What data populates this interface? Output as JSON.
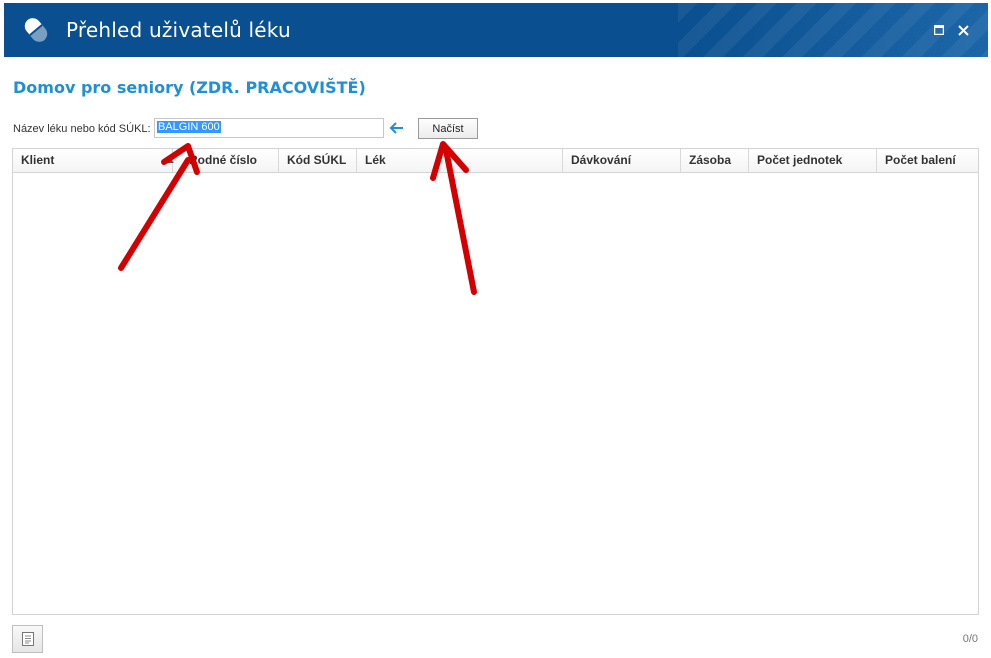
{
  "window": {
    "title": "Přehled uživatelů léku",
    "accent_color": "#0a4f8f",
    "icons": {
      "app": "pill-icon",
      "maximize": "maximize-icon",
      "close": "close-icon"
    }
  },
  "section": {
    "title": "Domov pro seniory (ZDR. PRACOVIŠTĚ)",
    "color": "#1f8fd6"
  },
  "search": {
    "label": "Název léku nebo kód SÚKL:",
    "value": "BALGIN 600",
    "load_button": "Načíst",
    "arrow_icon": "arrow-left-icon"
  },
  "grid": {
    "columns": [
      "Klient",
      "Rodné číslo",
      "Kód SÚKL",
      "Lék",
      "Dávkování",
      "Zásoba",
      "Počet jednotek",
      "Počet balení"
    ],
    "sorted_column": "Klient",
    "rows": []
  },
  "footer": {
    "report_icon": "document-icon",
    "pager": "0/0"
  },
  "annotations": {
    "color": "#d40000",
    "count": 2
  }
}
